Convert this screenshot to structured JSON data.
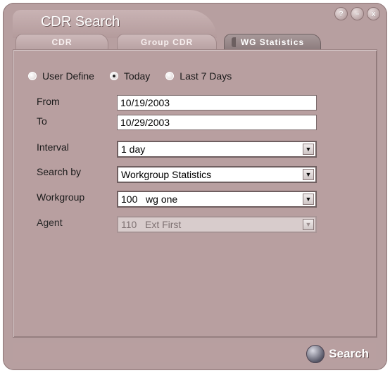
{
  "window": {
    "title": "CDR Search",
    "controls": [
      {
        "name": "help-icon",
        "glyph": "?"
      },
      {
        "name": "minimize-icon",
        "glyph": "–"
      },
      {
        "name": "close-icon",
        "glyph": "x"
      }
    ]
  },
  "tabs": [
    {
      "label": "CDR",
      "active": false
    },
    {
      "label": "Group CDR",
      "active": false
    },
    {
      "label": "WG Statistics",
      "active": true
    }
  ],
  "date_range": {
    "options": [
      {
        "label": "User Define",
        "checked": false
      },
      {
        "label": "Today",
        "checked": true
      },
      {
        "label": "Last 7 Days",
        "checked": false
      }
    ]
  },
  "form": {
    "from": {
      "label": "From",
      "value": "10/19/2003"
    },
    "to": {
      "label": "To",
      "value": "10/29/2003"
    },
    "interval": {
      "label": "Interval",
      "value": "1 day"
    },
    "search_by": {
      "label": "Search by",
      "value": "Workgroup Statistics"
    },
    "workgroup": {
      "label": "Workgroup",
      "value": "100   wg one"
    },
    "agent": {
      "label": "Agent",
      "value": "110   Ext First",
      "disabled": true
    }
  },
  "actions": {
    "search_label": "Search"
  },
  "colors": {
    "window_bg": "#b79fa0",
    "active_tab": "#8c7c7d",
    "text": "#1a1a1a"
  }
}
